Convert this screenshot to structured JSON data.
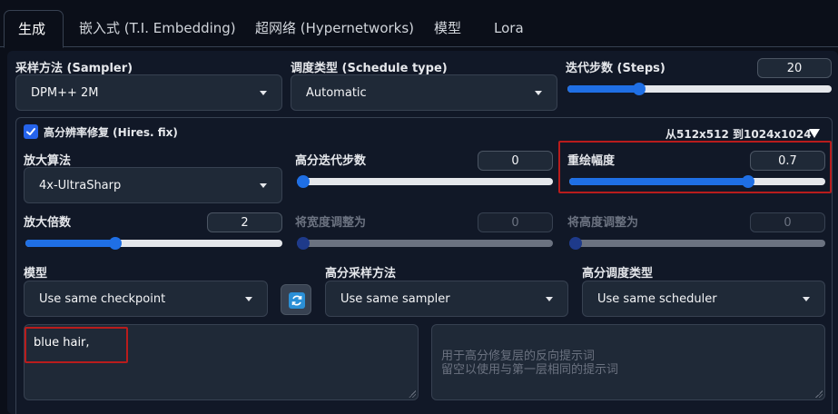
{
  "tabs": [
    {
      "label": "生成"
    },
    {
      "label": "嵌入式 (T.I. Embedding)"
    },
    {
      "label": "超网络 (Hypernetworks)"
    },
    {
      "label": "模型"
    },
    {
      "label": "Lora"
    }
  ],
  "sampler": {
    "label": "采样方法 (Sampler)",
    "value": "DPM++ 2M"
  },
  "schedule": {
    "label": "调度类型 (Schedule type)",
    "value": "Automatic"
  },
  "steps": {
    "label": "迭代步数 (Steps)",
    "value": "20",
    "fraction": 0.27
  },
  "hires": {
    "checkbox_label": "高分辨率修复 (Hires. fix)",
    "resolution_note": "从512x512 到1024x1024",
    "upscaler": {
      "label": "放大算法",
      "value": "4x-UltraSharp"
    },
    "hires_steps": {
      "label": "高分迭代步数",
      "value": "0",
      "fraction": 0.0
    },
    "denoise": {
      "label": "重绘幅度",
      "value": "0.7",
      "fraction": 0.7
    },
    "upscale_by": {
      "label": "放大倍数",
      "value": "2",
      "fraction": 0.35
    },
    "resize_width": {
      "label": "将宽度调整为",
      "value": "0",
      "fraction": 0.0
    },
    "resize_height": {
      "label": "将高度调整为",
      "value": "0",
      "fraction": 0.0
    },
    "checkpoint": {
      "label": "模型",
      "value": "Use same checkpoint"
    },
    "hires_sampler": {
      "label": "高分采样方法",
      "value": "Use same sampler"
    },
    "hires_scheduler": {
      "label": "高分调度类型",
      "value": "Use same scheduler"
    },
    "prompt": {
      "value": "blue hair,"
    },
    "negative_prompt": {
      "placeholder": "用于高分修复层的反向提示词\n留空以使用与第一层相同的提示词"
    }
  },
  "colors": {
    "accent": "#1f6fe5",
    "highlight": "#b91c1c"
  }
}
